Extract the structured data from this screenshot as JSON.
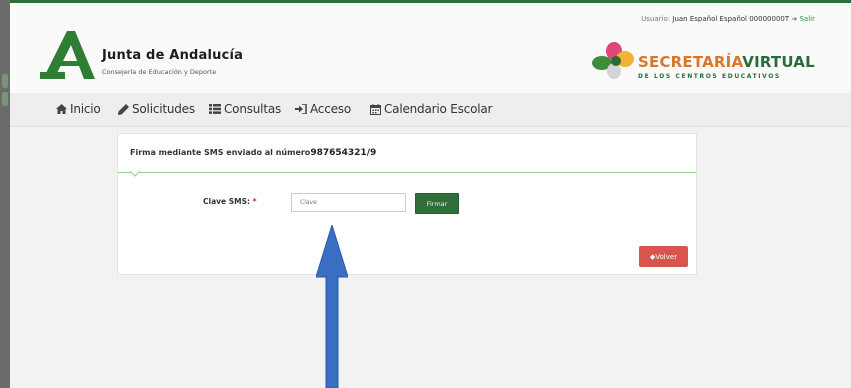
{
  "header": {
    "user_label": "Usuario:",
    "user_name": "Juan Español Español 00000000T",
    "logout_label": "Salir",
    "org_title": "Junta de Andalucía",
    "org_subtitle": "Consejería de Educación y Deporte",
    "sv_title_part1": "SECRETARÍA",
    "sv_title_part2": "VIRTUAL",
    "sv_subtitle": "DE LOS CENTROS EDUCATIVOS"
  },
  "nav": {
    "items": [
      {
        "label": "Inicio",
        "icon": "home-icon"
      },
      {
        "label": "Solicitudes",
        "icon": "pencil-icon"
      },
      {
        "label": "Consultas",
        "icon": "list-icon"
      },
      {
        "label": "Acceso",
        "icon": "sign-in-icon"
      },
      {
        "label": "Calendario Escolar",
        "icon": "calendar-icon"
      }
    ]
  },
  "card": {
    "title": "Firma mediante SMS enviado al número",
    "phone": "987654321",
    "phone_tail": "/9",
    "field_label": "Clave SMS:",
    "required_mark": "*",
    "input_value": "",
    "input_placeholder": "Clave",
    "submit_label": "Firmar",
    "back_label": "Volver"
  },
  "colors": {
    "brand_green": "#2e6e3a",
    "accent_orange": "#d9762b",
    "danger": "#d9534f",
    "arrow_blue": "#3b6fc4"
  }
}
